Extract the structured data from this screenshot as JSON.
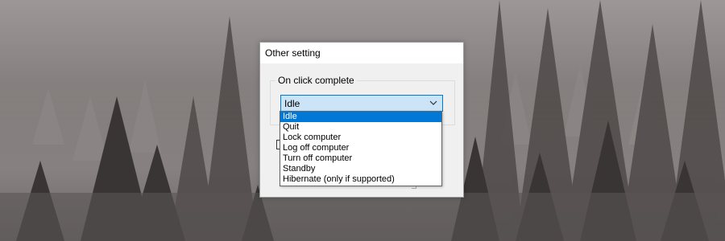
{
  "dialog": {
    "title": "Other setting",
    "group_label": "On click complete",
    "combo": {
      "selected": "Idle",
      "icon": "chevron-down-icon"
    },
    "options": [
      {
        "label": "Idle",
        "selected": true
      },
      {
        "label": "Quit",
        "selected": false
      },
      {
        "label": "Lock computer",
        "selected": false
      },
      {
        "label": "Log off computer",
        "selected": false
      },
      {
        "label": "Turn off computer",
        "selected": false
      },
      {
        "label": "Standby",
        "selected": false
      },
      {
        "label": "Hibernate (only if supported)",
        "selected": false
      }
    ]
  },
  "colors": {
    "accent": "#0078d7",
    "combo_bg": "#cce4f7",
    "dialog_bg": "#f0f0f0"
  }
}
